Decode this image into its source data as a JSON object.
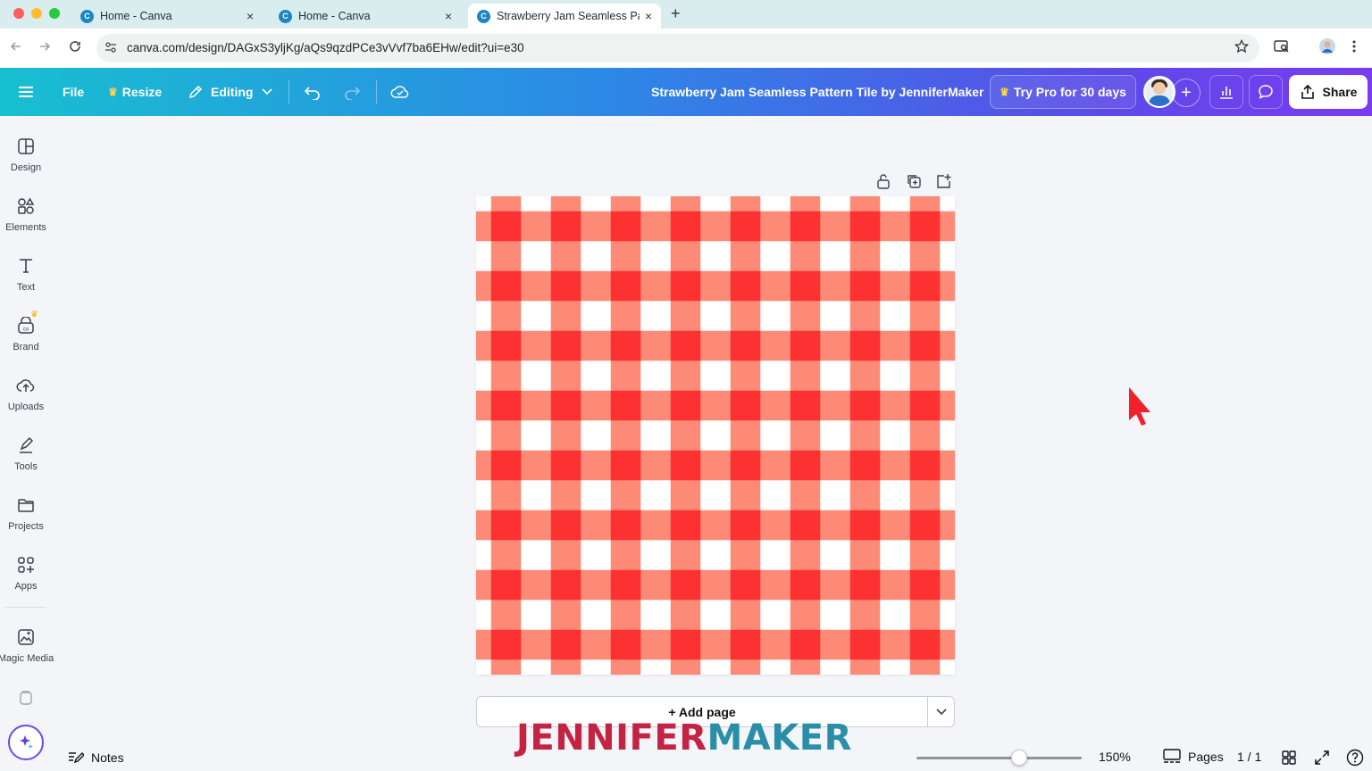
{
  "browser": {
    "tabs": [
      {
        "title": "Home - Canva",
        "favicon": "canva-favicon",
        "favicon_letter": "C"
      },
      {
        "title": "Home - Canva",
        "favicon": "canva-favicon",
        "favicon_letter": "C"
      },
      {
        "title": "Strawberry Jam Seamless Pat",
        "favicon": "canva-favicon",
        "favicon_letter": "C",
        "active": true
      }
    ],
    "close_glyph": "×",
    "new_tab_glyph": "+",
    "url": "canva.com/design/DAGxS3yljKg/aQs9qzdPCe3vVvf7ba6EHw/edit?ui=e30"
  },
  "toolbar": {
    "menu_icon": "hamburger-menu-icon",
    "file_label": "File",
    "resize_label": "Resize",
    "editing_label": "Editing",
    "document_title": "Strawberry Jam Seamless Pattern Tile by JenniferMaker",
    "try_pro_label": "Try Pro for 30 days",
    "share_label": "Share",
    "plus_glyph": "+"
  },
  "sidebar": {
    "items": [
      {
        "label": "Design",
        "icon": "design-icon"
      },
      {
        "label": "Elements",
        "icon": "elements-icon"
      },
      {
        "label": "Text",
        "icon": "text-icon"
      },
      {
        "label": "Brand",
        "icon": "brand-icon"
      },
      {
        "label": "Uploads",
        "icon": "uploads-icon"
      },
      {
        "label": "Tools",
        "icon": "tools-icon"
      },
      {
        "label": "Projects",
        "icon": "projects-icon"
      },
      {
        "label": "Apps",
        "icon": "apps-icon"
      },
      {
        "label": "Magic Media",
        "icon": "magic-media-icon"
      }
    ]
  },
  "canvas": {
    "add_page_label": "+ Add page",
    "pattern": {
      "stripe_count": 16,
      "colors": {
        "background": "#ffffff",
        "light": "#fd8a76",
        "dark": "#fc3232"
      }
    }
  },
  "watermark": {
    "part1": "JENNIFER",
    "part2": "MAKER"
  },
  "footer": {
    "notes_label": "Notes",
    "zoom_level": "150%",
    "zoom_fraction": 0.62,
    "pages_label": "Pages",
    "page_count": "1 / 1"
  },
  "colors": {
    "toolbar_gradient_start": "#18bfd1",
    "toolbar_gradient_end": "#7a3bf0",
    "watermark_red": "#c42342",
    "watermark_teal": "#2a8fa6",
    "cursor_red": "#f2202b"
  }
}
